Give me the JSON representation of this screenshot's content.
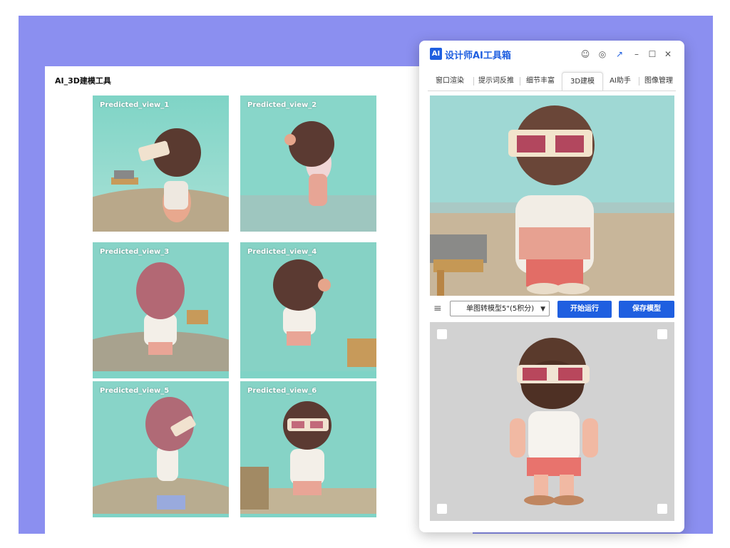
{
  "left_panel": {
    "title": "AI_3D建模工具",
    "views": [
      {
        "label": "Predicted_view_1"
      },
      {
        "label": "Predicted_view_2"
      },
      {
        "label": "Predicted_view_3"
      },
      {
        "label": "Predicted_view_4"
      },
      {
        "label": "Predicted_view_5"
      },
      {
        "label": "Predicted_view_6"
      }
    ]
  },
  "window": {
    "logo_text": "AI",
    "title": "设计师AI工具箱",
    "controls": {
      "user": "☺",
      "settings": "◎",
      "pin": "↗",
      "minimize": "–",
      "maximize": "☐",
      "close": "✕"
    },
    "tabs": [
      {
        "label": "窗口渲染"
      },
      {
        "label": "提示词反推"
      },
      {
        "label": "细节丰富"
      },
      {
        "label": "3D建模"
      },
      {
        "label": "AI助手"
      },
      {
        "label": "图像管理"
      }
    ],
    "active_tab": "3D建模",
    "menu_icon": "≡",
    "model_select": {
      "value": "单图转模型5\"(5积分)"
    },
    "select_arrow": "▼",
    "start_button": "开始运行",
    "save_button": "保存模型"
  },
  "colors": {
    "accent": "#1f5fe0",
    "backdrop": "#8b8ff0"
  }
}
